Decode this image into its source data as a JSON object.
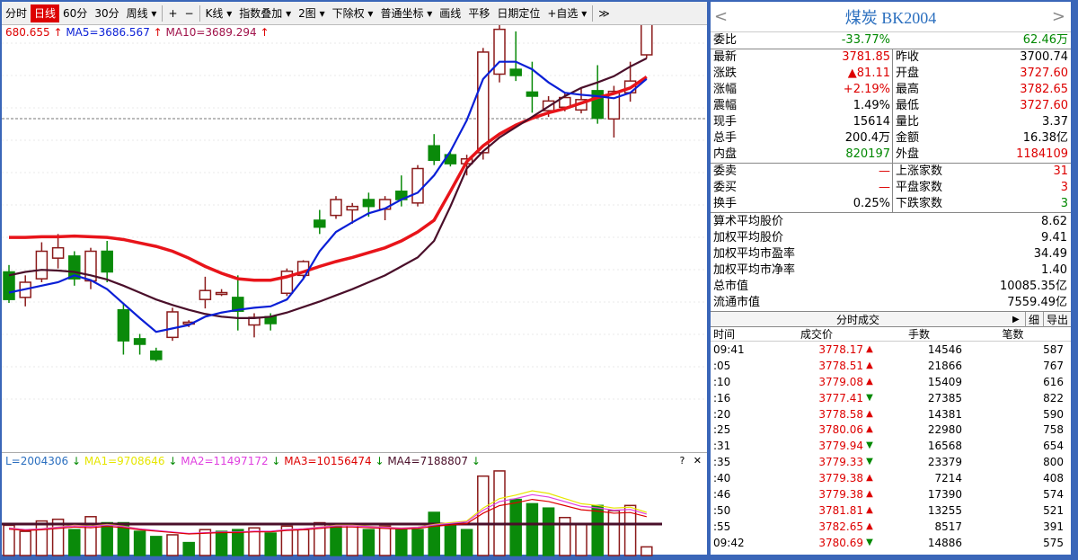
{
  "toolbar": {
    "items": [
      "分时",
      "日线",
      "60分",
      "30分",
      "周线 ▾",
      "+",
      "−",
      "K线 ▾",
      "指数叠加 ▾",
      "2图 ▾",
      "下除权 ▾",
      "普通坐标 ▾",
      "画线",
      "平移",
      "日期定位",
      "+自选 ▾",
      "≫"
    ],
    "active": "日线"
  },
  "ma_legend": {
    "first": "680.655",
    "ma5": "MA5=3686.567",
    "ma10": "MA10=3689.294"
  },
  "vol_legend": {
    "vol": "L=2004306",
    "ma1": "MA1=9708646",
    "ma2": "MA2=11497172",
    "ma3": "MA3=10156474",
    "ma4": "MA4=7188807"
  },
  "vol_icons": {
    "help": "?",
    "close": "✕"
  },
  "colors": {
    "up": "#8b1a1a",
    "down": "#0a8a0a",
    "ma5": "#0a1fd6",
    "ma10": "#e8141a",
    "ma20": "#4a0f2a",
    "accent": "#3a66b8"
  },
  "chart_data": {
    "type": "candlestick",
    "ylim": [
      3250,
      3850
    ],
    "candles": [
      {
        "o": 3505,
        "c": 3465,
        "h": 3515,
        "l": 3460
      },
      {
        "o": 3468,
        "c": 3490,
        "h": 3500,
        "l": 3455
      },
      {
        "o": 3495,
        "c": 3535,
        "h": 3548,
        "l": 3490
      },
      {
        "o": 3525,
        "c": 3540,
        "h": 3560,
        "l": 3510
      },
      {
        "o": 3528,
        "c": 3495,
        "h": 3535,
        "l": 3485
      },
      {
        "o": 3492,
        "c": 3535,
        "h": 3540,
        "l": 3480
      },
      {
        "o": 3535,
        "c": 3505,
        "h": 3550,
        "l": 3490
      },
      {
        "o": 3450,
        "c": 3405,
        "h": 3460,
        "l": 3385
      },
      {
        "o": 3408,
        "c": 3400,
        "h": 3415,
        "l": 3385
      },
      {
        "o": 3390,
        "c": 3378,
        "h": 3395,
        "l": 3375
      },
      {
        "o": 3410,
        "c": 3447,
        "h": 3453,
        "l": 3405
      },
      {
        "o": 3432,
        "c": 3432,
        "h": 3435,
        "l": 3425
      },
      {
        "o": 3465,
        "c": 3478,
        "h": 3498,
        "l": 3452
      },
      {
        "o": 3475,
        "c": 3475,
        "h": 3480,
        "l": 3470
      },
      {
        "o": 3468,
        "c": 3448,
        "h": 3500,
        "l": 3420
      },
      {
        "o": 3428,
        "c": 3439,
        "h": 3445,
        "l": 3410
      },
      {
        "o": 3440,
        "c": 3430,
        "h": 3445,
        "l": 3420
      },
      {
        "o": 3474,
        "c": 3506,
        "h": 3510,
        "l": 3470
      },
      {
        "o": 3500,
        "c": 3520,
        "h": 3522,
        "l": 3495
      },
      {
        "o": 3580,
        "c": 3570,
        "h": 3595,
        "l": 3560
      },
      {
        "o": 3587,
        "c": 3610,
        "h": 3615,
        "l": 3582
      },
      {
        "o": 3595,
        "c": 3600,
        "h": 3605,
        "l": 3575
      },
      {
        "o": 3610,
        "c": 3600,
        "h": 3620,
        "l": 3585
      },
      {
        "o": 3596,
        "c": 3610,
        "h": 3615,
        "l": 3580
      },
      {
        "o": 3622,
        "c": 3610,
        "h": 3645,
        "l": 3600
      },
      {
        "o": 3605,
        "c": 3655,
        "h": 3660,
        "l": 3600
      },
      {
        "o": 3688,
        "c": 3667,
        "h": 3705,
        "l": 3660
      },
      {
        "o": 3675,
        "c": 3662,
        "h": 3680,
        "l": 3658
      },
      {
        "o": 3662,
        "c": 3669,
        "h": 3675,
        "l": 3645
      },
      {
        "o": 3678,
        "c": 3824,
        "h": 3830,
        "l": 3668
      },
      {
        "o": 3792,
        "c": 3857,
        "h": 3905,
        "l": 3780
      },
      {
        "o": 3799,
        "c": 3790,
        "h": 3854,
        "l": 3782
      },
      {
        "o": 3766,
        "c": 3760,
        "h": 3810,
        "l": 3736
      },
      {
        "o": 3739,
        "c": 3753,
        "h": 3760,
        "l": 3730
      },
      {
        "o": 3744,
        "c": 3758,
        "h": 3765,
        "l": 3738
      },
      {
        "o": 3740,
        "c": 3755,
        "h": 3772,
        "l": 3735
      },
      {
        "o": 3768,
        "c": 3728,
        "h": 3805,
        "l": 3720
      },
      {
        "o": 3727,
        "c": 3767,
        "h": 3775,
        "l": 3700
      },
      {
        "o": 3765,
        "c": 3782,
        "h": 3810,
        "l": 3752
      },
      {
        "o": 3820,
        "c": 3868,
        "h": 3873,
        "l": 3815
      }
    ],
    "ma5": [
      3475,
      3480,
      3485,
      3490,
      3500,
      3493,
      3480,
      3459,
      3438,
      3418,
      3423,
      3428,
      3440,
      3446,
      3450,
      3453,
      3455,
      3465,
      3495,
      3535,
      3563,
      3577,
      3590,
      3597,
      3610,
      3620,
      3645,
      3680,
      3725,
      3785,
      3810,
      3810,
      3799,
      3780,
      3765,
      3762,
      3760,
      3757,
      3765,
      3785
    ],
    "ma10": [
      3555,
      3555,
      3556,
      3556,
      3557,
      3556,
      3555,
      3552,
      3547,
      3542,
      3535,
      3525,
      3513,
      3503,
      3495,
      3493,
      3493,
      3498,
      3505,
      3513,
      3520,
      3526,
      3533,
      3540,
      3550,
      3563,
      3580,
      3622,
      3665,
      3688,
      3705,
      3718,
      3728,
      3736,
      3742,
      3750,
      3758,
      3764,
      3772,
      3788
    ],
    "ma20": [
      3500,
      3505,
      3508,
      3507,
      3505,
      3500,
      3494,
      3485,
      3475,
      3465,
      3457,
      3450,
      3444,
      3440,
      3438,
      3438,
      3440,
      3446,
      3454,
      3462,
      3471,
      3480,
      3490,
      3500,
      3513,
      3526,
      3550,
      3600,
      3655,
      3680,
      3700,
      3715,
      3730,
      3745,
      3760,
      3772,
      3780,
      3789,
      3803,
      3815
    ],
    "volume": [
      {
        "v": 0.35,
        "up": true
      },
      {
        "v": 0.28,
        "up": true
      },
      {
        "v": 0.4,
        "up": true
      },
      {
        "v": 0.42,
        "up": true
      },
      {
        "v": 0.3,
        "up": false
      },
      {
        "v": 0.45,
        "up": true
      },
      {
        "v": 0.38,
        "up": false
      },
      {
        "v": 0.38,
        "up": false
      },
      {
        "v": 0.28,
        "up": false
      },
      {
        "v": 0.22,
        "up": false
      },
      {
        "v": 0.24,
        "up": true
      },
      {
        "v": 0.15,
        "up": false
      },
      {
        "v": 0.3,
        "up": true
      },
      {
        "v": 0.28,
        "up": false
      },
      {
        "v": 0.3,
        "up": false
      },
      {
        "v": 0.32,
        "up": true
      },
      {
        "v": 0.26,
        "up": false
      },
      {
        "v": 0.34,
        "up": true
      },
      {
        "v": 0.3,
        "up": true
      },
      {
        "v": 0.38,
        "up": true
      },
      {
        "v": 0.36,
        "up": false
      },
      {
        "v": 0.35,
        "up": true
      },
      {
        "v": 0.3,
        "up": false
      },
      {
        "v": 0.34,
        "up": true
      },
      {
        "v": 0.3,
        "up": false
      },
      {
        "v": 0.3,
        "up": false
      },
      {
        "v": 0.5,
        "up": false
      },
      {
        "v": 0.35,
        "up": false
      },
      {
        "v": 0.3,
        "up": false
      },
      {
        "v": 0.92,
        "up": true
      },
      {
        "v": 0.98,
        "up": true
      },
      {
        "v": 0.65,
        "up": false
      },
      {
        "v": 0.6,
        "up": false
      },
      {
        "v": 0.55,
        "up": false
      },
      {
        "v": 0.44,
        "up": true
      },
      {
        "v": 0.36,
        "up": true
      },
      {
        "v": 0.58,
        "up": false
      },
      {
        "v": 0.52,
        "up": true
      },
      {
        "v": 0.58,
        "up": true
      },
      {
        "v": 0.1,
        "up": true
      }
    ]
  },
  "quote": {
    "title": "煤炭  BK2004",
    "nav_left": "<",
    "nav_right": ">",
    "weibi": {
      "label": "委比",
      "value": "-33.77%",
      "value2": "62.46万"
    },
    "rows": [
      {
        "l1": "最新",
        "v1": "3781.85",
        "l2": "昨收",
        "v2": "3700.74",
        "c1": "red",
        "c2": "black"
      },
      {
        "l1": "涨跌",
        "v1": "▲81.11",
        "l2": "开盘",
        "v2": "3727.60",
        "c1": "red",
        "c2": "red"
      },
      {
        "l1": "涨幅",
        "v1": "+2.19%",
        "l2": "最高",
        "v2": "3782.65",
        "c1": "red",
        "c2": "red"
      },
      {
        "l1": "震幅",
        "v1": "1.49%",
        "l2": "最低",
        "v2": "3727.60",
        "c1": "black",
        "c2": "red"
      },
      {
        "l1": "现手",
        "v1": "15614",
        "l2": "量比",
        "v2": "3.37",
        "c1": "black",
        "c2": "black"
      },
      {
        "l1": "总手",
        "v1": "200.4万",
        "l2": "金额",
        "v2": "16.38亿",
        "c1": "black",
        "c2": "black"
      },
      {
        "l1": "内盘",
        "v1": "820197",
        "l2": "外盘",
        "v2": "1184109",
        "c1": "green",
        "c2": "red"
      }
    ],
    "rows2": [
      {
        "l1": "委卖",
        "v1": "—",
        "l2": "上涨家数",
        "v2": "31",
        "c1": "red",
        "c2": "red"
      },
      {
        "l1": "委买",
        "v1": "—",
        "l2": "平盘家数",
        "v2": "3",
        "c1": "red",
        "c2": "red"
      },
      {
        "l1": "换手",
        "v1": "0.25%",
        "l2": "下跌家数",
        "v2": "3",
        "c1": "black",
        "c2": "green"
      }
    ],
    "stats": [
      {
        "label": "算术平均股价",
        "value": "8.62"
      },
      {
        "label": "加权平均股价",
        "value": "9.41"
      },
      {
        "label": "加权平均市盈率",
        "value": "34.49"
      },
      {
        "label": "加权平均市净率",
        "value": "1.40"
      },
      {
        "label": "总市值",
        "value": "10085.35亿"
      },
      {
        "label": "流通市值",
        "value": "7559.49亿"
      }
    ]
  },
  "ticks": {
    "header": "分时成交",
    "btn_play": "▶",
    "btn_detail": "细",
    "btn_export": "导出",
    "cols": [
      "时间",
      "成交价",
      "手数",
      "笔数"
    ],
    "rows": [
      {
        "t": "09:41",
        "p": "3778.17",
        "d": "▲",
        "v": "14546",
        "n": "587",
        "up": true
      },
      {
        "t": ":05",
        "p": "3778.51",
        "d": "▲",
        "v": "21866",
        "n": "767",
        "up": true
      },
      {
        "t": ":10",
        "p": "3779.08",
        "d": "▲",
        "v": "15409",
        "n": "616",
        "up": true
      },
      {
        "t": ":16",
        "p": "3777.41",
        "d": "▼",
        "v": "27385",
        "n": "822",
        "up": false
      },
      {
        "t": ":20",
        "p": "3778.58",
        "d": "▲",
        "v": "14381",
        "n": "590",
        "up": true
      },
      {
        "t": ":25",
        "p": "3780.06",
        "d": "▲",
        "v": "22980",
        "n": "758",
        "up": true
      },
      {
        "t": ":31",
        "p": "3779.94",
        "d": "▼",
        "v": "16568",
        "n": "654",
        "up": false
      },
      {
        "t": ":35",
        "p": "3779.33",
        "d": "▼",
        "v": "23379",
        "n": "800",
        "up": false
      },
      {
        "t": ":40",
        "p": "3779.38",
        "d": "▲",
        "v": "7214",
        "n": "408",
        "up": true
      },
      {
        "t": ":46",
        "p": "3779.38",
        "d": "▲",
        "v": "17390",
        "n": "574",
        "up": true
      },
      {
        "t": ":50",
        "p": "3781.81",
        "d": "▲",
        "v": "13255",
        "n": "521",
        "up": true
      },
      {
        "t": ":55",
        "p": "3782.65",
        "d": "▲",
        "v": "8517",
        "n": "391",
        "up": true
      },
      {
        "t": "09:42",
        "p": "3780.69",
        "d": "▼",
        "v": "14886",
        "n": "575",
        "up": false
      }
    ]
  }
}
